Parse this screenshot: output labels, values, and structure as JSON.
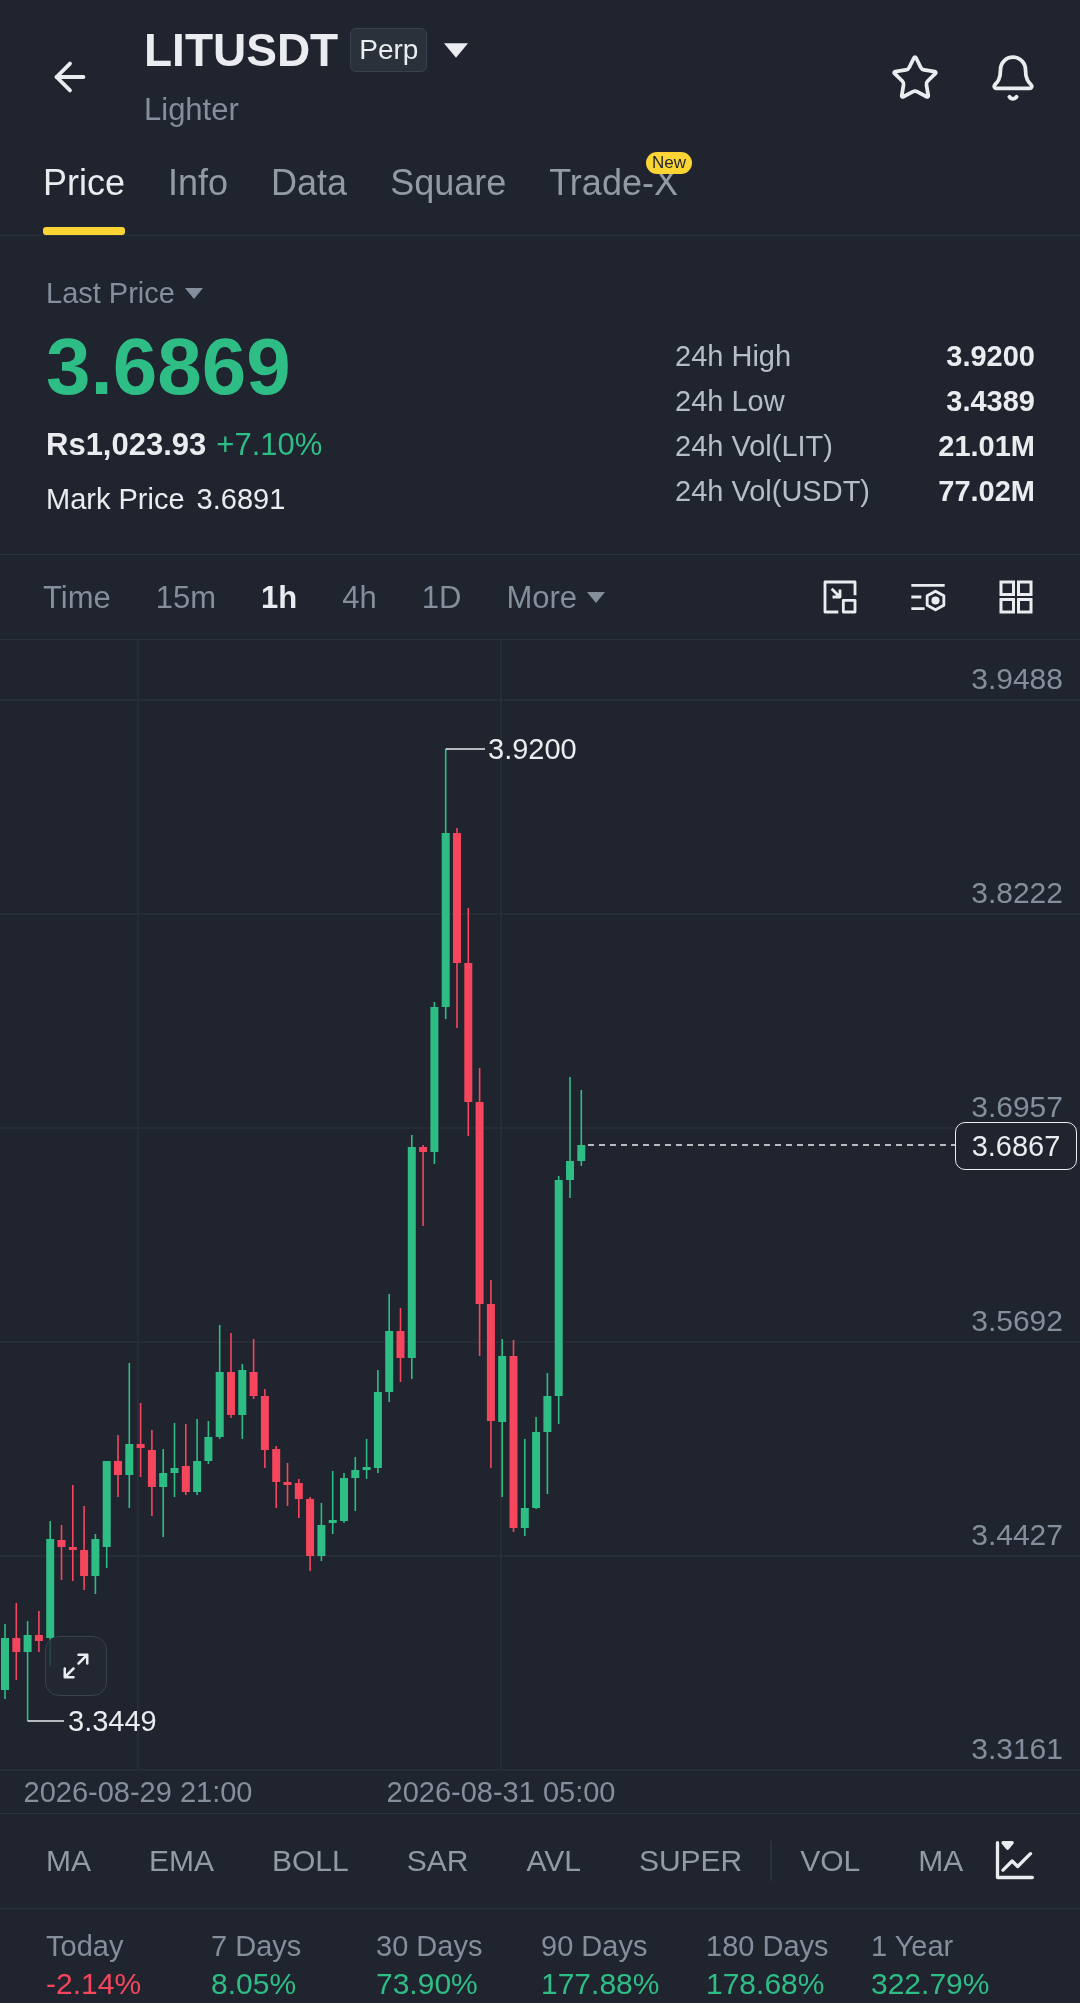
{
  "header": {
    "title": "LITUSDT",
    "badge": "Perp",
    "subtitle": "Lighter"
  },
  "tabs": [
    {
      "label": "Price",
      "selected": true
    },
    {
      "label": "Info",
      "selected": false
    },
    {
      "label": "Data",
      "selected": false
    },
    {
      "label": "Square",
      "selected": false
    },
    {
      "label": "Trade-X",
      "selected": false,
      "badge": "New"
    }
  ],
  "price": {
    "label": "Last Price",
    "value": "3.6869",
    "rising": true,
    "fiat": "Rs1,023.93",
    "change": "+7.10%",
    "mark_label": "Mark Price",
    "mark_value": "3.6891"
  },
  "stats": [
    {
      "label": "24h High",
      "value": "3.9200"
    },
    {
      "label": "24h Low",
      "value": "3.4389"
    },
    {
      "label": "24h Vol(LIT)",
      "value": "21.01M"
    },
    {
      "label": "24h Vol(USDT)",
      "value": "77.02M"
    }
  ],
  "intervals": [
    {
      "label": "Time",
      "kind": "option",
      "selected": false
    },
    {
      "label": "15m",
      "kind": "option",
      "selected": false
    },
    {
      "label": "1h",
      "kind": "option",
      "selected": true
    },
    {
      "label": "4h",
      "kind": "option",
      "selected": false
    },
    {
      "label": "1D",
      "kind": "option",
      "selected": false
    },
    {
      "label": "More",
      "kind": "menu",
      "selected": false
    }
  ],
  "chart": {
    "price_labels": [
      "3.9488",
      "3.8222",
      "3.6957",
      "3.5692",
      "3.4427",
      "3.3161"
    ],
    "time_labels": [
      "2026-08-29 21:00",
      "2026-08-31 05:00"
    ],
    "high_label": "3.9200",
    "low_label": "3.3449",
    "last_price": "3.6867"
  },
  "indicators": {
    "main": [
      "MA",
      "EMA",
      "BOLL",
      "SAR",
      "AVL",
      "SUPER"
    ],
    "sub": [
      "VOL",
      "MA"
    ]
  },
  "performance": [
    {
      "label": "Today",
      "value": "-2.14%",
      "color": "#f6465d"
    },
    {
      "label": "7 Days",
      "value": "8.05%",
      "color": "#2ebd85"
    },
    {
      "label": "30 Days",
      "value": "73.90%",
      "color": "#2ebd85"
    },
    {
      "label": "90 Days",
      "value": "177.88%",
      "color": "#2ebd85"
    },
    {
      "label": "180 Days",
      "value": "178.68%",
      "color": "#2ebd85"
    },
    {
      "label": "1 Year",
      "value": "322.79%",
      "color": "#2ebd85"
    }
  ]
}
